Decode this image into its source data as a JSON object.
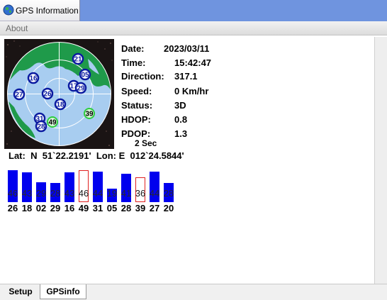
{
  "window": {
    "title": "GPS Information"
  },
  "menu": {
    "about": "About"
  },
  "info": {
    "date_label": "Date:",
    "date": "2023/03/11",
    "time_label": "Time:",
    "time": "15:42:47",
    "direction_label": "Direction:",
    "direction": "317.1",
    "speed_label": "Speed:",
    "speed": "0 Km/hr",
    "status_label": "Status:",
    "status": "3D",
    "hdop_label": "HDOP:",
    "hdop": "0.8",
    "pdop_label": "PDOP:",
    "pdop": "1.3",
    "interval": "2 Sec"
  },
  "position": {
    "lat_label": "Lat:",
    "lat_hemi": "N",
    "lat": "51`22.2191'",
    "lon_label": "Lon:",
    "lon_hemi": "E",
    "lon": "012`24.5844'"
  },
  "skyplot": {
    "satellites": [
      {
        "prn": "21",
        "state": "used"
      },
      {
        "prn": "16",
        "state": "used"
      },
      {
        "prn": "05",
        "state": "used"
      },
      {
        "prn": "27",
        "state": "used"
      },
      {
        "prn": "26",
        "state": "used"
      },
      {
        "prn": "17",
        "state": "used"
      },
      {
        "prn": "29",
        "state": "used"
      },
      {
        "prn": "18",
        "state": "used"
      },
      {
        "prn": "31",
        "state": "used"
      },
      {
        "prn": "28",
        "state": "used"
      },
      {
        "prn": "49",
        "state": "unused"
      },
      {
        "prn": "39",
        "state": "unused"
      }
    ]
  },
  "signals": [
    {
      "prn": "26",
      "snr": "46",
      "used": true
    },
    {
      "prn": "18",
      "snr": "43",
      "used": true
    },
    {
      "prn": "02",
      "snr": "29",
      "used": true
    },
    {
      "prn": "29",
      "snr": "28",
      "used": true
    },
    {
      "prn": "16",
      "snr": "43",
      "used": true
    },
    {
      "prn": "49",
      "snr": "46",
      "used": false
    },
    {
      "prn": "31",
      "snr": "44",
      "used": true
    },
    {
      "prn": "05",
      "snr": "19",
      "used": true
    },
    {
      "prn": "28",
      "snr": "41",
      "used": true
    },
    {
      "prn": "39",
      "snr": "36",
      "used": false
    },
    {
      "prn": "27",
      "snr": "44",
      "used": true
    },
    {
      "prn": "20",
      "snr": "28",
      "used": true
    }
  ],
  "tabs": {
    "setup": "Setup",
    "gpsinfo": "GPSinfo"
  },
  "colors": {
    "used_bar": "#0000ee",
    "unused_outline": "#e02020",
    "title_blue": "#6f94df"
  }
}
